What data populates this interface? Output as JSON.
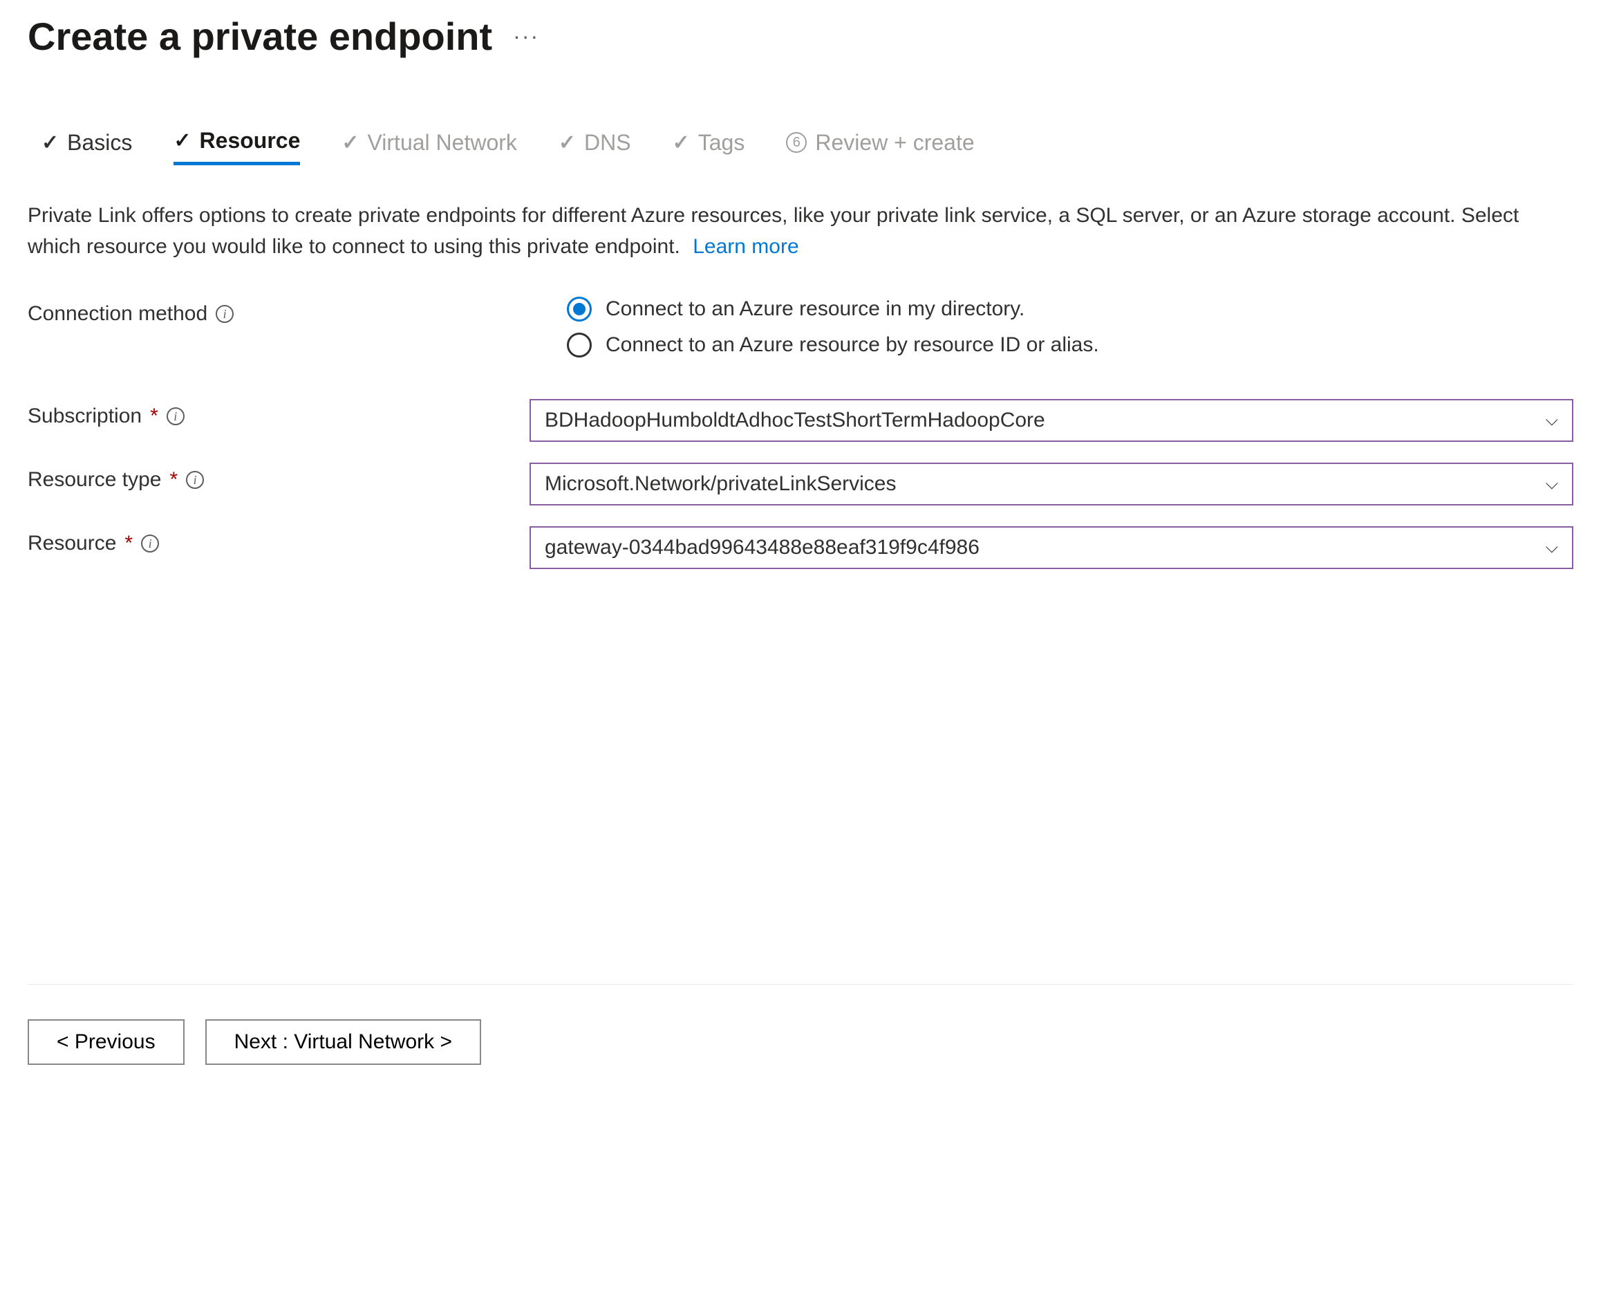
{
  "header": {
    "title": "Create a private endpoint"
  },
  "tabs": {
    "basics": "Basics",
    "resource": "Resource",
    "virtual_network": "Virtual Network",
    "dns": "DNS",
    "tags": "Tags",
    "review_step": "6",
    "review": "Review + create"
  },
  "description": {
    "text": "Private Link offers options to create private endpoints for different Azure resources, like your private link service, a SQL server, or an Azure storage account. Select which resource you would like to connect to using this private endpoint.",
    "learn_more": "Learn more"
  },
  "form": {
    "connection_method": {
      "label": "Connection method",
      "option1": "Connect to an Azure resource in my directory.",
      "option2": "Connect to an Azure resource by resource ID or alias."
    },
    "subscription": {
      "label": "Subscription",
      "value": "BDHadoopHumboldtAdhocTestShortTermHadoopCore"
    },
    "resource_type": {
      "label": "Resource type",
      "value": "Microsoft.Network/privateLinkServices"
    },
    "resource": {
      "label": "Resource",
      "value": "gateway-0344bad99643488e88eaf319f9c4f986"
    }
  },
  "footer": {
    "previous": "< Previous",
    "next": "Next : Virtual Network >"
  }
}
